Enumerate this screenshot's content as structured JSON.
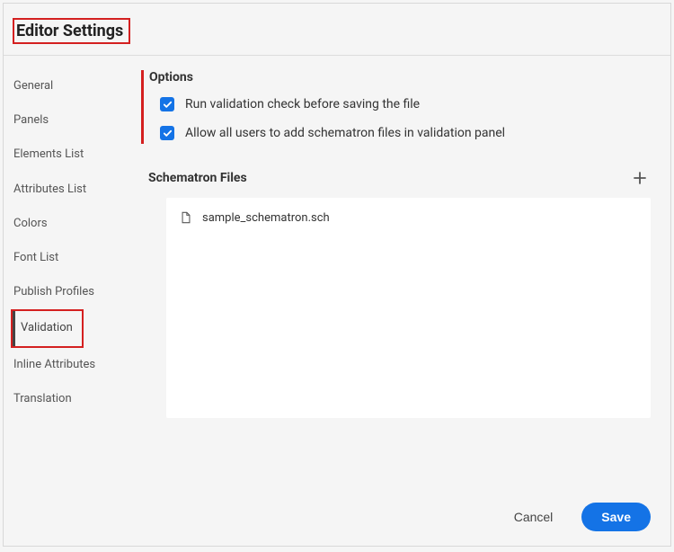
{
  "header": {
    "title": "Editor Settings"
  },
  "sidebar": {
    "items": [
      {
        "label": "General",
        "active": false
      },
      {
        "label": "Panels",
        "active": false
      },
      {
        "label": "Elements List",
        "active": false
      },
      {
        "label": "Attributes List",
        "active": false
      },
      {
        "label": "Colors",
        "active": false
      },
      {
        "label": "Font List",
        "active": false
      },
      {
        "label": "Publish Profiles",
        "active": false
      },
      {
        "label": "Validation",
        "active": true
      },
      {
        "label": "Inline Attributes",
        "active": false
      },
      {
        "label": "Translation",
        "active": false
      }
    ]
  },
  "main": {
    "options_title": "Options",
    "option1_label": "Run validation check before saving the file",
    "option1_checked": true,
    "option2_label": "Allow all users to add schematron files in validation panel",
    "option2_checked": true,
    "files_title": "Schematron Files",
    "files": [
      {
        "name": "sample_schematron.sch"
      }
    ]
  },
  "footer": {
    "cancel_label": "Cancel",
    "save_label": "Save"
  },
  "colors": {
    "accent": "#1473e6",
    "highlight": "#d42020"
  }
}
